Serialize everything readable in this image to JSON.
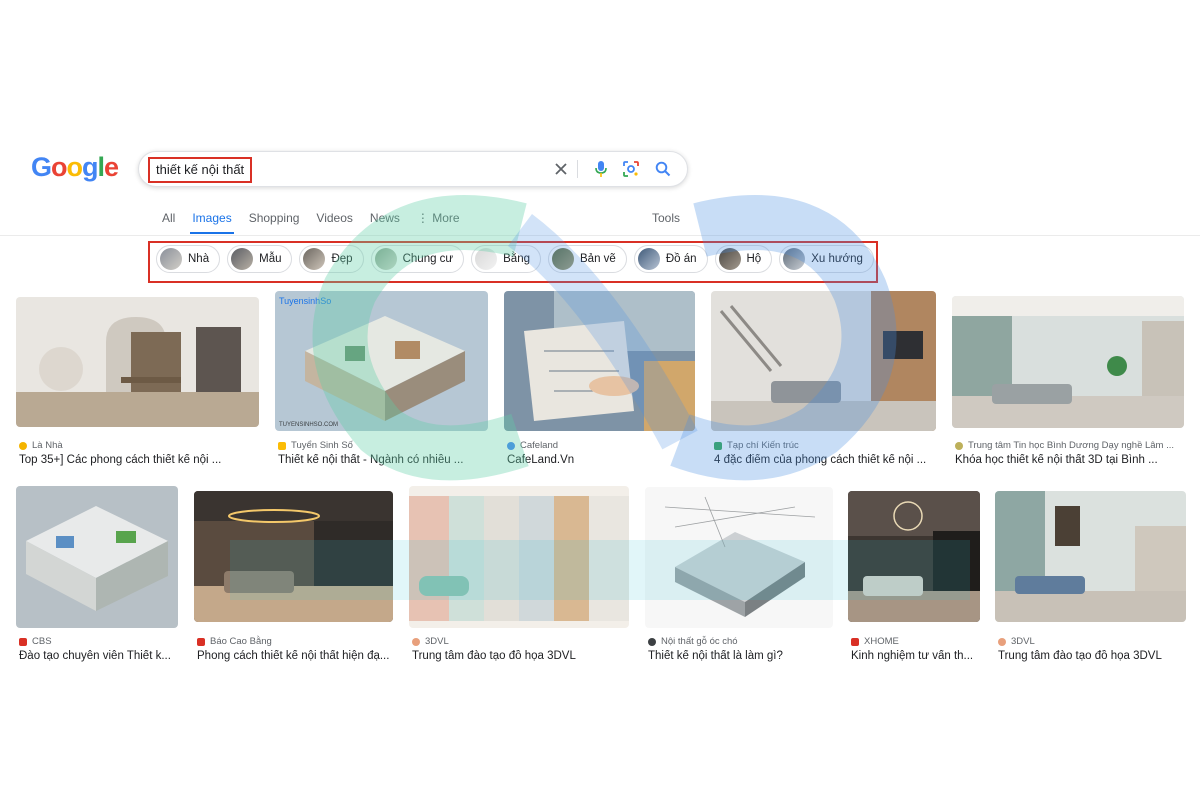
{
  "logo": {
    "letters": [
      "G",
      "o",
      "o",
      "g",
      "l",
      "e"
    ],
    "colors": [
      "#4285f4",
      "#ea4335",
      "#fbbc05",
      "#4285f4",
      "#34a853",
      "#ea4335"
    ]
  },
  "search": {
    "query": "thiết kế nội thất"
  },
  "icons": {
    "clear": "close-icon",
    "voice": "microphone-icon",
    "lens": "camera-lens-icon",
    "search": "search-icon"
  },
  "tabs": [
    "All",
    "Images",
    "Shopping",
    "Videos",
    "News",
    "⋮ More"
  ],
  "active_tab": "Images",
  "tools_label": "Tools",
  "chips": [
    "Nhà",
    "Mẫu",
    "Đẹp",
    "Chung cư",
    "Bằng",
    "Bản vẽ",
    "Đồ án",
    "Hộ",
    "Xu hướng"
  ],
  "results_row1": [
    {
      "source": "Là Nhà",
      "title": "Top 35+] Các phong cách thiết kế nội ..."
    },
    {
      "source": "Tuyển Sinh Số",
      "title": "Thiết kế nội thất - Ngành có nhiều ..."
    },
    {
      "source": "Cafeland",
      "title": "CafeLand.Vn"
    },
    {
      "source": "Tạp chí Kiến trúc",
      "title": "4 đặc điểm của phong cách thiết kế nội ..."
    },
    {
      "source": "Trung tâm Tin học Bình Dương Dạy nghề Lâm ...",
      "title": "Khóa học thiết kế nội thất 3D tại Bình ..."
    }
  ],
  "results_row2": [
    {
      "source": "CBS",
      "title": "Đào tạo chuyên viên Thiết k..."
    },
    {
      "source": "Báo Cao Bằng",
      "title": "Phong cách thiết kế nội thất hiện đạ..."
    },
    {
      "source": "3DVL",
      "title": "Trung tâm đào tạo đồ họa 3DVL"
    },
    {
      "source": "Nội thất gỗ óc chó",
      "title": "Thiết kế nội thất là làm gì?"
    },
    {
      "source": "XHOME",
      "title": "Kinh nghiệm tư vấn th..."
    },
    {
      "source": "3DVL",
      "title": "Trung tâm đào tạo đồ họa 3DVL"
    }
  ],
  "thumb_text": {
    "tuyensinh_logo": "TuyensinhSo",
    "tuyensinh_url": "TUYENSINHSO.COM"
  }
}
